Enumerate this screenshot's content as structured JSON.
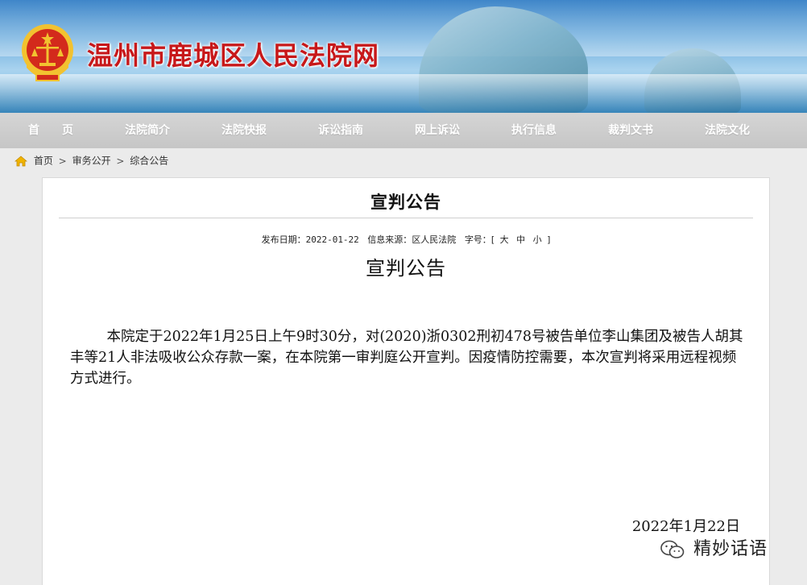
{
  "header": {
    "site_title": "温州市鹿城区人民法院网"
  },
  "nav": {
    "items": [
      {
        "label": "首　　页"
      },
      {
        "label": "法院简介"
      },
      {
        "label": "法院快报"
      },
      {
        "label": "诉讼指南"
      },
      {
        "label": "网上诉讼"
      },
      {
        "label": "执行信息"
      },
      {
        "label": "裁判文书"
      },
      {
        "label": "法院文化"
      }
    ]
  },
  "breadcrumb": {
    "items": [
      "首页",
      "审务公开",
      "综合公告"
    ],
    "separator": ">"
  },
  "article": {
    "title": "宣判公告",
    "meta": {
      "date_label": "发布日期：",
      "date_value": "2022-01-22",
      "source_label": "信息来源：",
      "source_value": "区人民法院",
      "font_label": "字号：",
      "bracket_open": "[",
      "font_large": "大",
      "font_medium": "中",
      "font_small": "小",
      "bracket_close": "]"
    },
    "doc_title": "宣判公告",
    "body": "本院定于2022年1月25日上午9时30分，对(2020)浙0302刑初478号被告单位李山集团及被告人胡其丰等21人非法吸收公众存款一案，在本院第一审判庭公开宣判。因疫情防控需要，本次宣判将采用远程视频方式进行。",
    "sign_date": "2022年1月22日"
  },
  "watermark": {
    "text": "精妙话语",
    "icon": "wechat-icon"
  },
  "colors": {
    "title_red": "#c7181a",
    "nav_bg": "#c9c9c9",
    "emblem_gold": "#f2c230",
    "emblem_red": "#d32a1c"
  }
}
